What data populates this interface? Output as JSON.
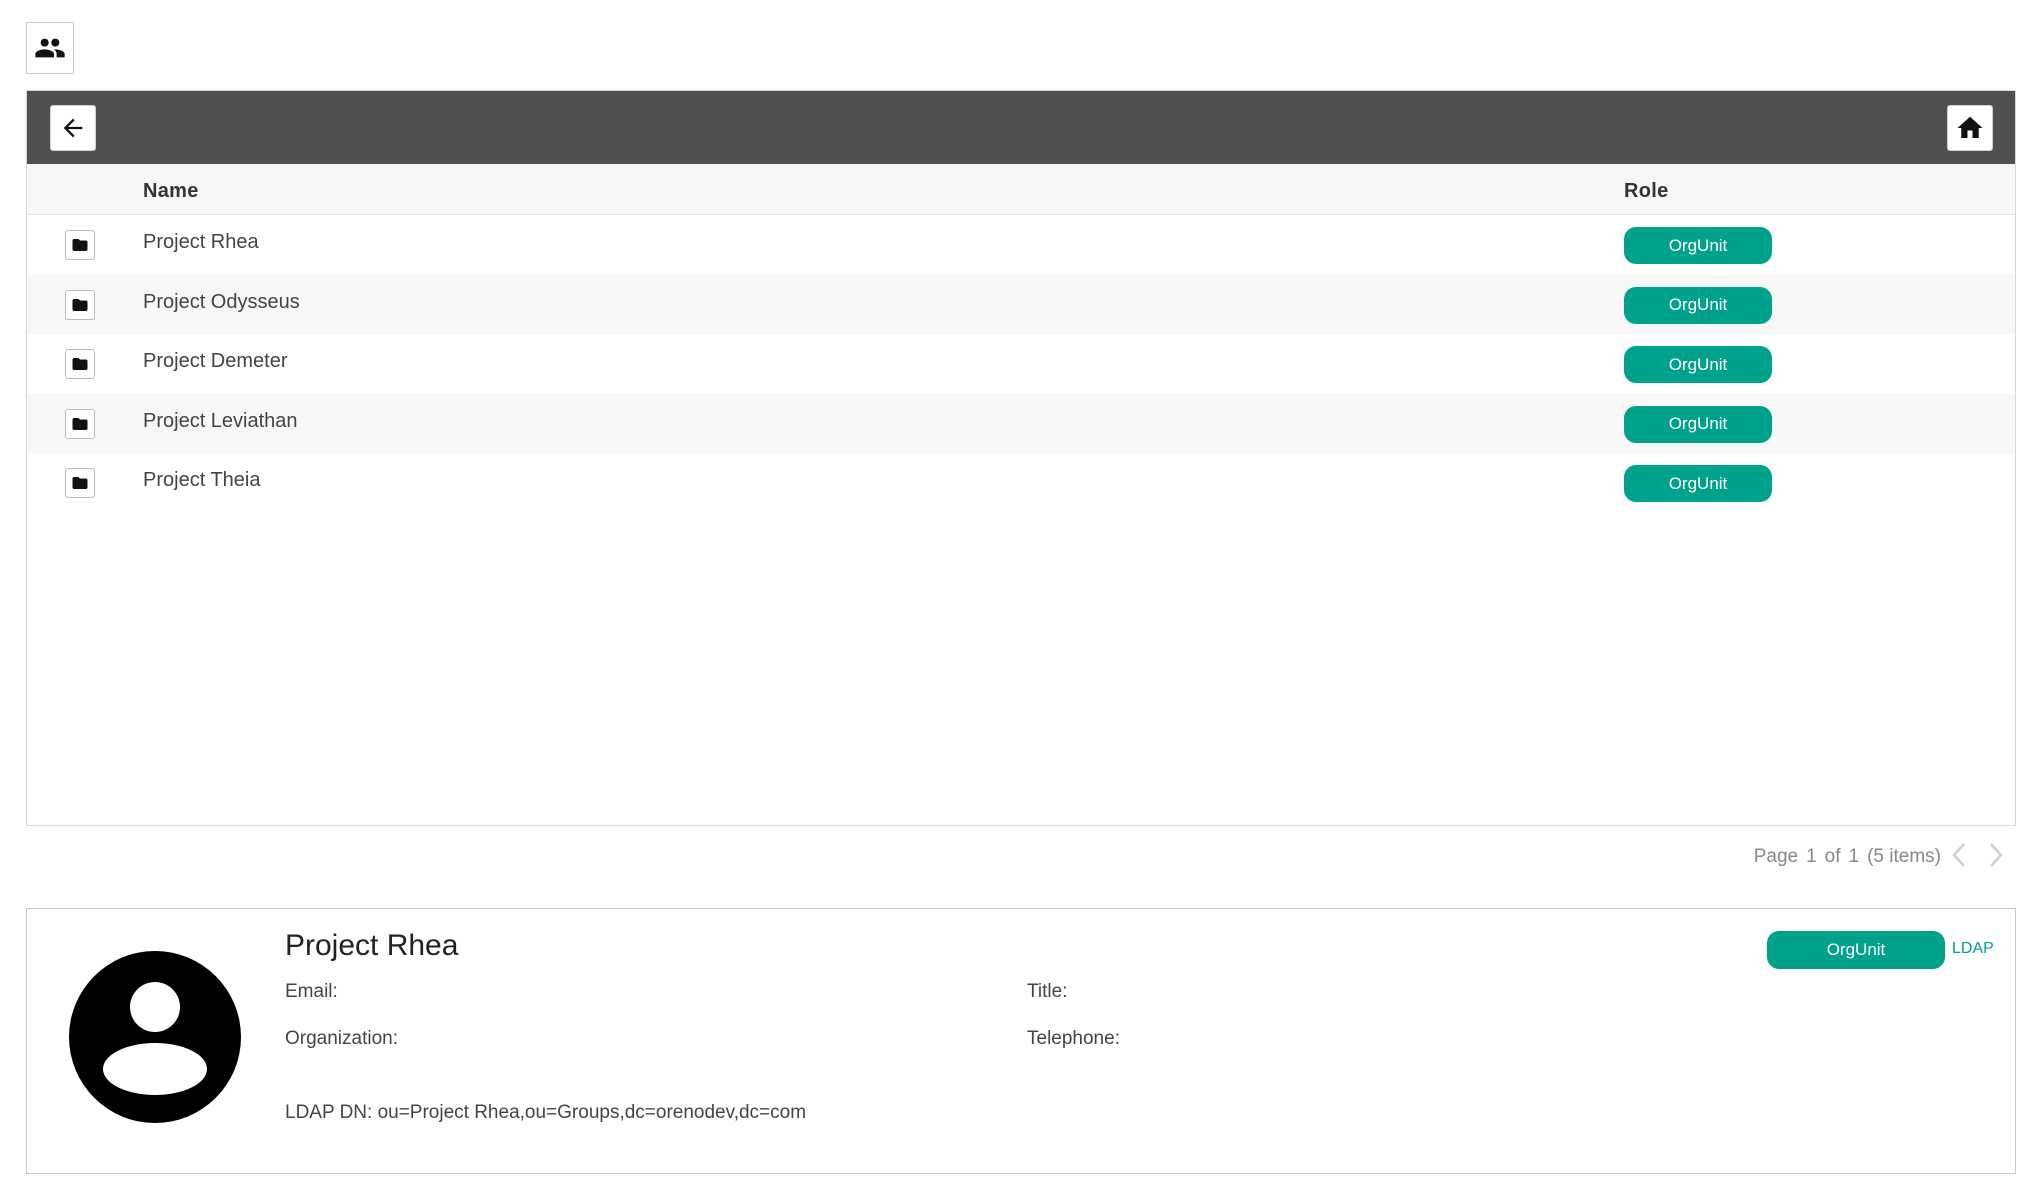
{
  "top": {
    "people_icon": "people-icon"
  },
  "toolbar": {
    "back_icon": "arrow-left-icon",
    "home_icon": "home-icon"
  },
  "table": {
    "headers": {
      "name": "Name",
      "role": "Role"
    },
    "rows": [
      {
        "name": "Project Rhea",
        "role": "OrgUnit"
      },
      {
        "name": "Project Odysseus",
        "role": "OrgUnit"
      },
      {
        "name": "Project Demeter",
        "role": "OrgUnit"
      },
      {
        "name": "Project Leviathan",
        "role": "OrgUnit"
      },
      {
        "name": "Project Theia",
        "role": "OrgUnit"
      }
    ]
  },
  "pager": {
    "page_label": "Page",
    "page": "1",
    "of_label": "of",
    "total_pages": "1",
    "items": "(5 items)"
  },
  "detail": {
    "title": "Project Rhea",
    "email_label": "Email:",
    "title_label": "Title:",
    "organization_label": "Organization:",
    "telephone_label": "Telephone:",
    "ldap_dn": "LDAP DN: ou=Project Rhea,ou=Groups,dc=orenodev,dc=com",
    "role": "OrgUnit",
    "source": "LDAP"
  },
  "colors": {
    "accent": "#01a28c",
    "toolbar": "#505052"
  }
}
